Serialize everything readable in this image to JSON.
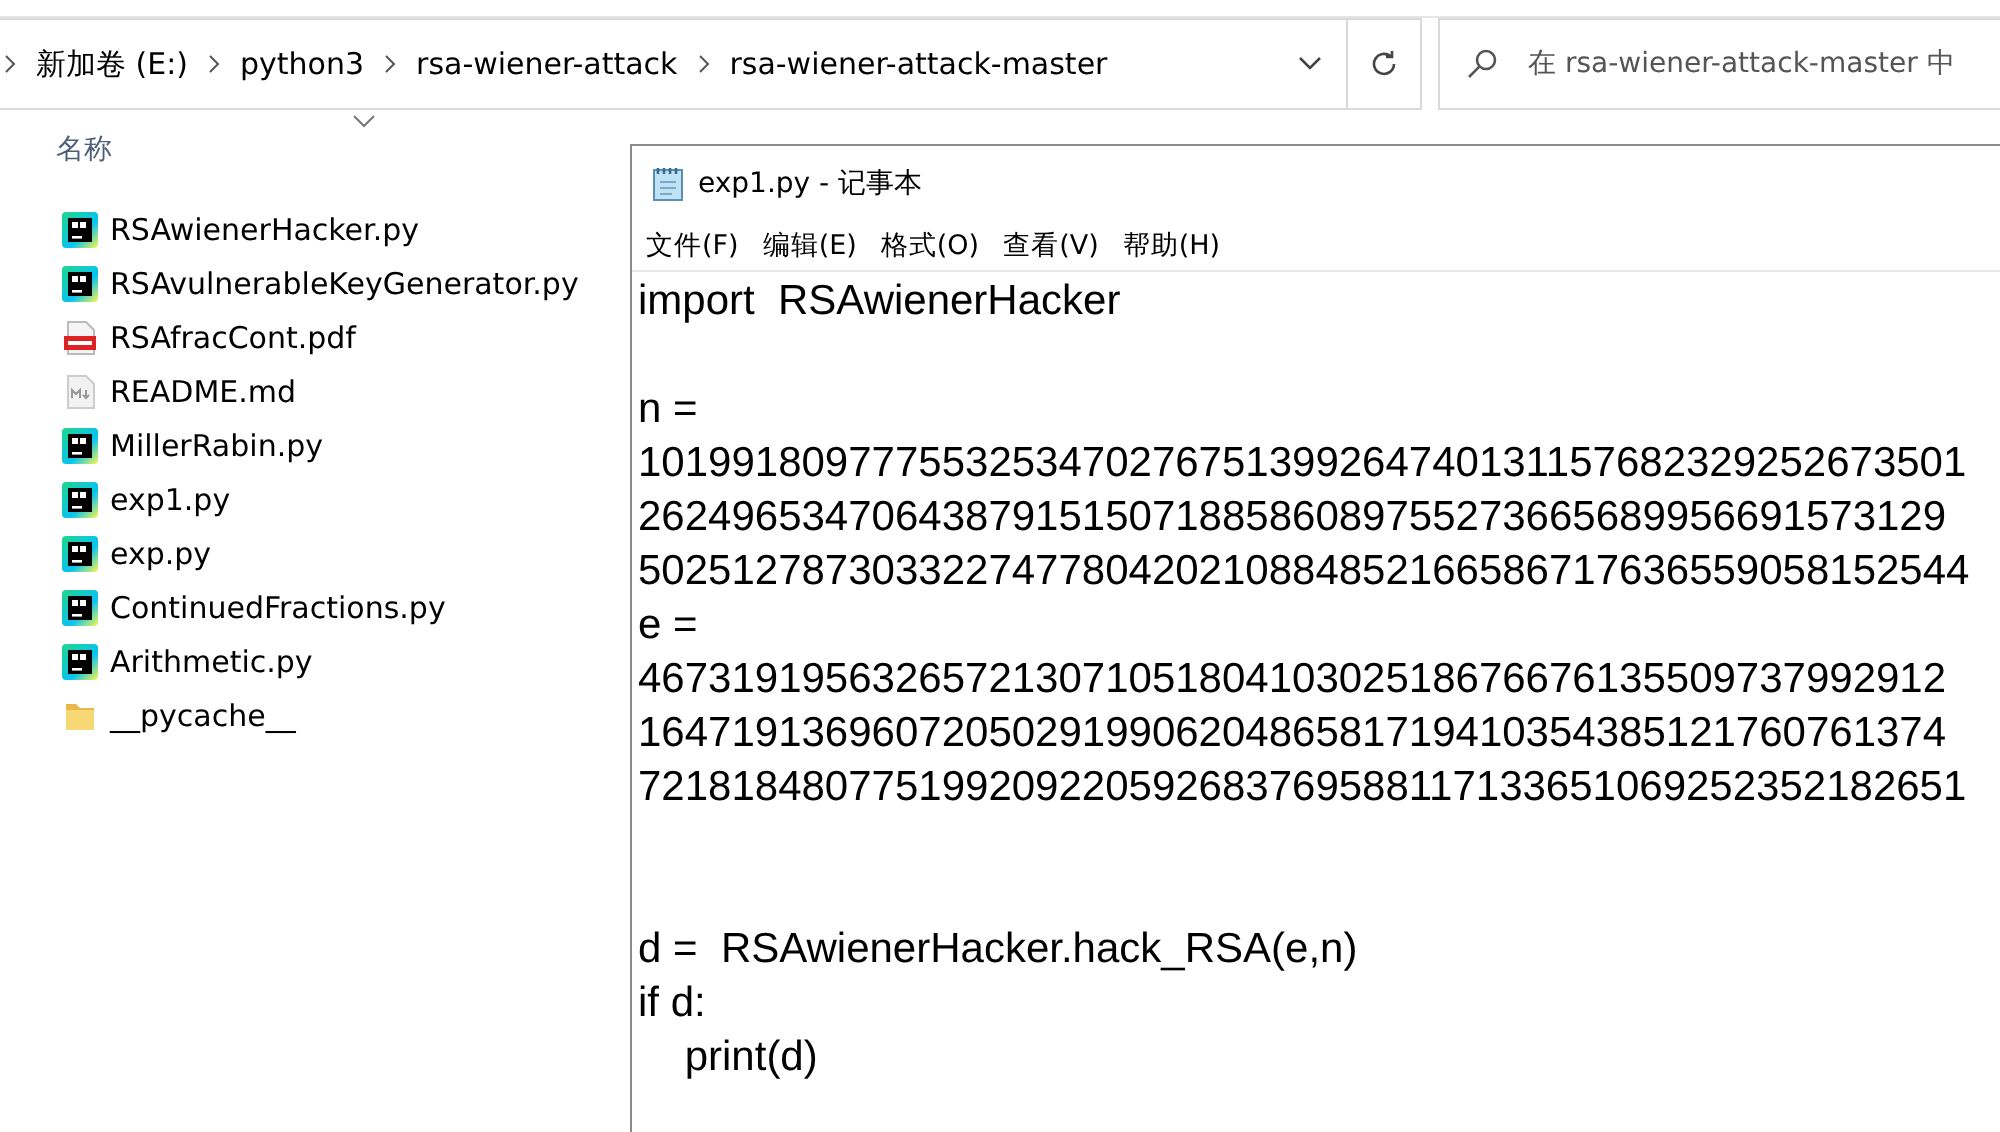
{
  "explorer": {
    "breadcrumb": [
      "新加卷 (E:)",
      "python3",
      "rsa-wiener-attack",
      "rsa-wiener-attack-master"
    ],
    "search": {
      "placeholder": "在 rsa-wiener-attack-master 中"
    },
    "column_header": "名称",
    "files": [
      {
        "name": "RSAwienerHacker.py",
        "kind": "pycharm"
      },
      {
        "name": "RSAvulnerableKeyGenerator.py",
        "kind": "pycharm"
      },
      {
        "name": "RSAfracCont.pdf",
        "kind": "pdf"
      },
      {
        "name": "README.md",
        "kind": "markdown"
      },
      {
        "name": "MillerRabin.py",
        "kind": "pycharm"
      },
      {
        "name": "exp1.py",
        "kind": "pycharm"
      },
      {
        "name": "exp.py",
        "kind": "pycharm"
      },
      {
        "name": "ContinuedFractions.py",
        "kind": "pycharm"
      },
      {
        "name": "Arithmetic.py",
        "kind": "pycharm"
      },
      {
        "name": "__pycache__",
        "kind": "folder"
      }
    ]
  },
  "notepad": {
    "title": "exp1.py - 记事本",
    "menu": [
      "文件(F)",
      "编辑(E)",
      "格式(O)",
      "查看(V)",
      "帮助(H)"
    ],
    "lines": [
      {
        "kind": "code",
        "text": "import  RSAwienerHacker"
      },
      {
        "kind": "blank"
      },
      {
        "kind": "code",
        "text": "n ="
      },
      {
        "kind": "code",
        "text": "101991809777553253470276751399264740131157682329252673501"
      },
      {
        "kind": "code",
        "text": "26249653470643879151507188586089755273665689956691573129"
      },
      {
        "kind": "code",
        "text": "502512787303322747780420210884852166586717636559058152544"
      },
      {
        "kind": "code",
        "text": "e ="
      },
      {
        "kind": "code",
        "text": "46731919563265721307105180410302518676676135509737992912"
      },
      {
        "kind": "code",
        "text": "16471913696072050291990620486581719410354385121760761374"
      },
      {
        "kind": "code",
        "text": "721818480775199209220592683769588117133651069252352182651"
      },
      {
        "kind": "blank"
      },
      {
        "kind": "blank"
      },
      {
        "kind": "code",
        "text": "d =  RSAwienerHacker.hack_RSA(e,n)"
      },
      {
        "kind": "code",
        "text": "if d:"
      },
      {
        "kind": "code",
        "text": "    print(d)"
      }
    ]
  }
}
